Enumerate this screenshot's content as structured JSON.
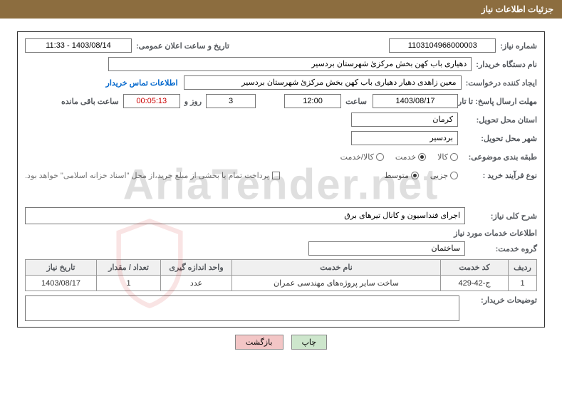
{
  "title_bar": "جزئیات اطلاعات نیاز",
  "labels": {
    "req_no": "شماره نیاز:",
    "announce_datetime": "تاریخ و ساعت اعلان عمومی:",
    "buyer_org": "نام دستگاه خریدار:",
    "requester": "ایجاد کننده درخواست:",
    "buyer_contact": "اطلاعات تماس خریدار",
    "deadline": "مهلت ارسال پاسخ: تا تاریخ:",
    "time": "ساعت",
    "day_and": "روز و",
    "remaining": "ساعت باقی مانده",
    "delivery_prov": "استان محل تحویل:",
    "delivery_city": "شهر محل تحویل:",
    "category": "طبقه بندی موضوعی:",
    "cat_kala": "کالا",
    "cat_khedmat": "خدمت",
    "cat_both": "کالا/خدمت",
    "process_type": "نوع فرآیند خرید :",
    "proc_joz": "جزیی",
    "proc_mid": "متوسط",
    "payment_note": "پرداخت تمام یا بخشی از مبلغ خرید،از محل \"اسناد خزانه اسلامی\" خواهد بود.",
    "desc_title": "شرح کلی نیاز:",
    "service_info": "اطلاعات خدمات مورد نیاز",
    "service_group": "گروه خدمت:",
    "buyer_notes": "توضیحات خریدار:"
  },
  "values": {
    "req_no": "1103104966000003",
    "announce_datetime": "1403/08/14 - 11:33",
    "buyer_org": "دهیاری باب کهن بخش مرکزئ شهرستان بردسیر",
    "requester": "معین زاهدی دهیار دهیاری باب کهن بخش مرکزئ شهرستان بردسیر",
    "deadline_date": "1403/08/17",
    "deadline_time": "12:00",
    "days_left": "3",
    "countdown": "00:05:13",
    "province": "کرمان",
    "city": "بردسیر",
    "desc": "اجرای فنداسیون و کانال تیرهای برق",
    "service_group": "ساختمان"
  },
  "table": {
    "headers": [
      "ردیف",
      "کد خدمت",
      "نام خدمت",
      "واحد اندازه گیری",
      "تعداد / مقدار",
      "تاریخ نیاز"
    ],
    "rows": [
      {
        "r": "1",
        "code": "ج-42-429",
        "name": "ساخت سایر پروژه‌های مهندسی عمران",
        "unit": "عدد",
        "qty": "1",
        "date": "1403/08/17"
      }
    ]
  },
  "buttons": {
    "print": "چاپ",
    "back": "بازگشت"
  },
  "watermark": "AriaTender.net"
}
